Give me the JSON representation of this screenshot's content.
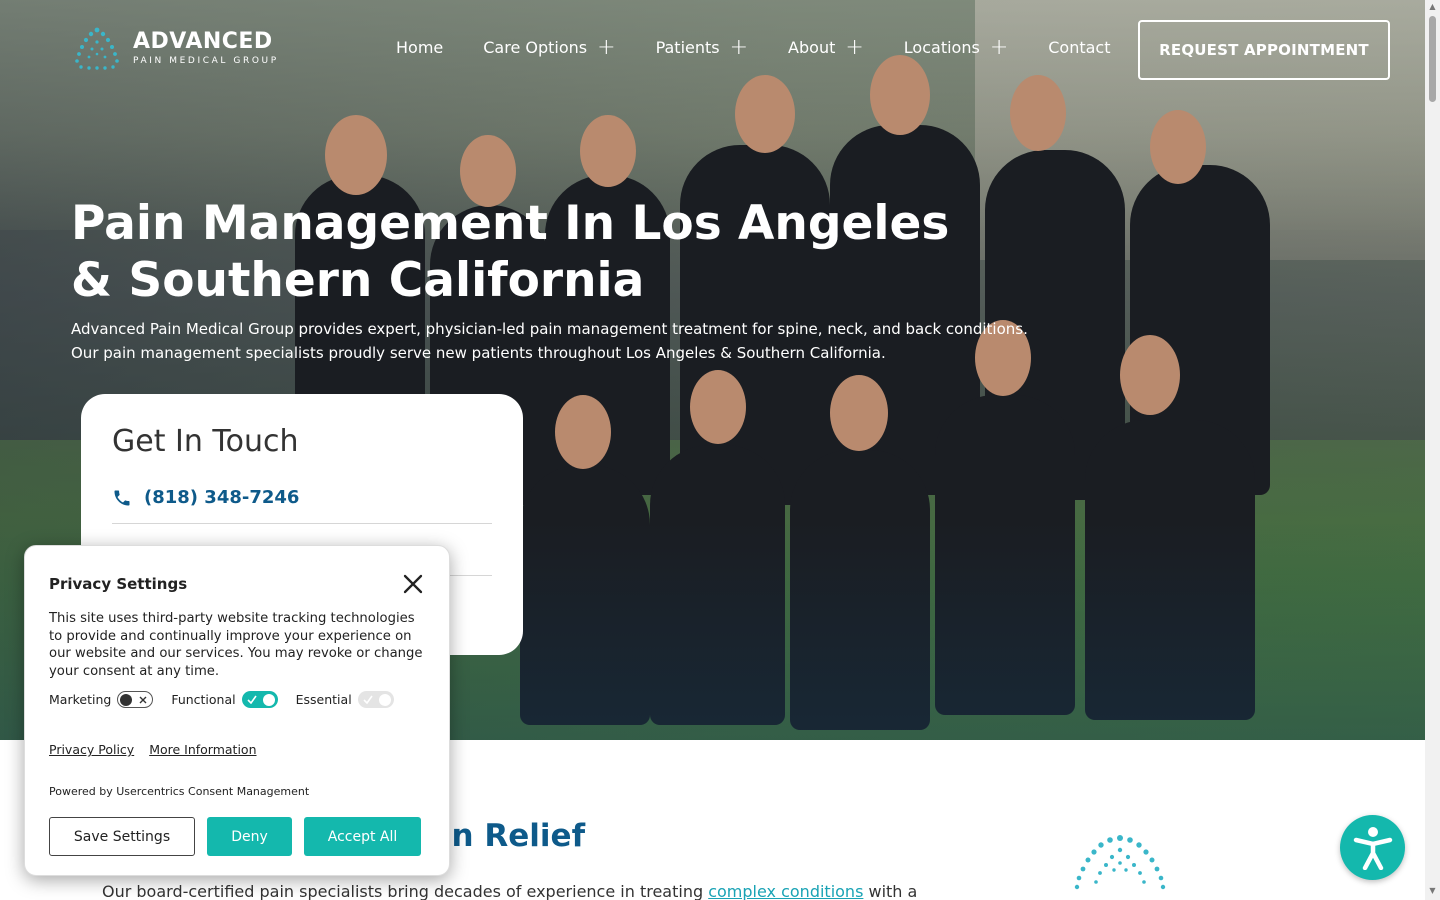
{
  "header": {
    "logo_main": "ADVANCED",
    "logo_sub": "PAIN MEDICAL GROUP",
    "nav": [
      {
        "label": "Home",
        "has_submenu": false
      },
      {
        "label": "Care Options",
        "has_submenu": true
      },
      {
        "label": "Patients",
        "has_submenu": true
      },
      {
        "label": "About",
        "has_submenu": true
      },
      {
        "label": "Locations",
        "has_submenu": true
      },
      {
        "label": "Contact",
        "has_submenu": false
      }
    ],
    "cta": "REQUEST APPOINTMENT"
  },
  "hero": {
    "title_line1": "Pain Management In Los Angeles",
    "title_line2": "& Southern California",
    "desc_line1": "Advanced Pain Medical Group provides expert, physician-led pain management treatment for spine, neck, and back conditions.",
    "desc_line2": "Our pain management specialists proudly serve new patients throughout Los Angeles & Southern California."
  },
  "touch": {
    "title": "Get In Touch",
    "phone": "(818) 348-7246"
  },
  "section": {
    "title_partial": "ain Relief",
    "text_before": "Our board-certified pain specialists bring decades of experience in treating ",
    "link": "complex conditions",
    "text_after": " with a"
  },
  "privacy": {
    "title": "Privacy Settings",
    "text": "This site uses third-party website tracking technologies to provide and continually improve your experience on our website and our services. You may revoke or change your consent at any time.",
    "toggles": [
      {
        "label": "Marketing",
        "state": "off"
      },
      {
        "label": "Functional",
        "state": "on"
      },
      {
        "label": "Essential",
        "state": "disabled"
      }
    ],
    "link_policy": "Privacy Policy",
    "link_more": "More Information",
    "powered": "Powered by Usercentrics Consent Management",
    "btn_save": "Save Settings",
    "btn_deny": "Deny",
    "btn_accept": "Accept All"
  },
  "colors": {
    "brand_blue": "#0e5a8a",
    "teal": "#14b8ad"
  },
  "icons": {
    "phone": "phone-icon",
    "close": "close-icon",
    "accessibility": "accessibility-icon"
  }
}
